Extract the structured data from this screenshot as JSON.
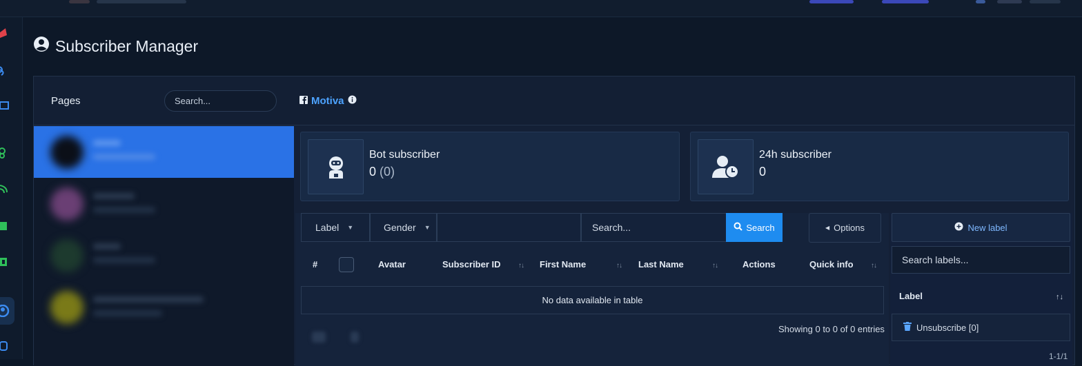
{
  "header": {
    "title": "Subscriber Manager"
  },
  "pages": {
    "label": "Pages",
    "search_placeholder": "Search..."
  },
  "selected_page": {
    "name": "Motiva"
  },
  "stats": [
    {
      "title": "Bot subscriber",
      "value": "0",
      "extra": "(0)",
      "icon": "robot-icon"
    },
    {
      "title": "24h subscriber",
      "value": "0",
      "extra": "",
      "icon": "user-clock-icon"
    }
  ],
  "filters": {
    "label_select": "Label",
    "gender_select": "Gender",
    "search_placeholder": "Search...",
    "search_button": "Search",
    "options_button": "Options"
  },
  "table": {
    "columns": [
      "#",
      "Avatar",
      "Subscriber ID",
      "First Name",
      "Last Name",
      "Actions",
      "Quick info"
    ],
    "empty_message": "No data available in table",
    "info": "Showing 0 to 0 of 0 entries"
  },
  "labels_panel": {
    "new_label_button": "New label",
    "search_placeholder": "Search labels...",
    "column_header": "Label",
    "items": [
      {
        "name": "Unsubscribe [0]"
      }
    ],
    "pagination": "1-1/1"
  },
  "colors": {
    "accent": "#1e8cf0",
    "link": "#4da3ff",
    "active_page": "#2a72e6"
  }
}
